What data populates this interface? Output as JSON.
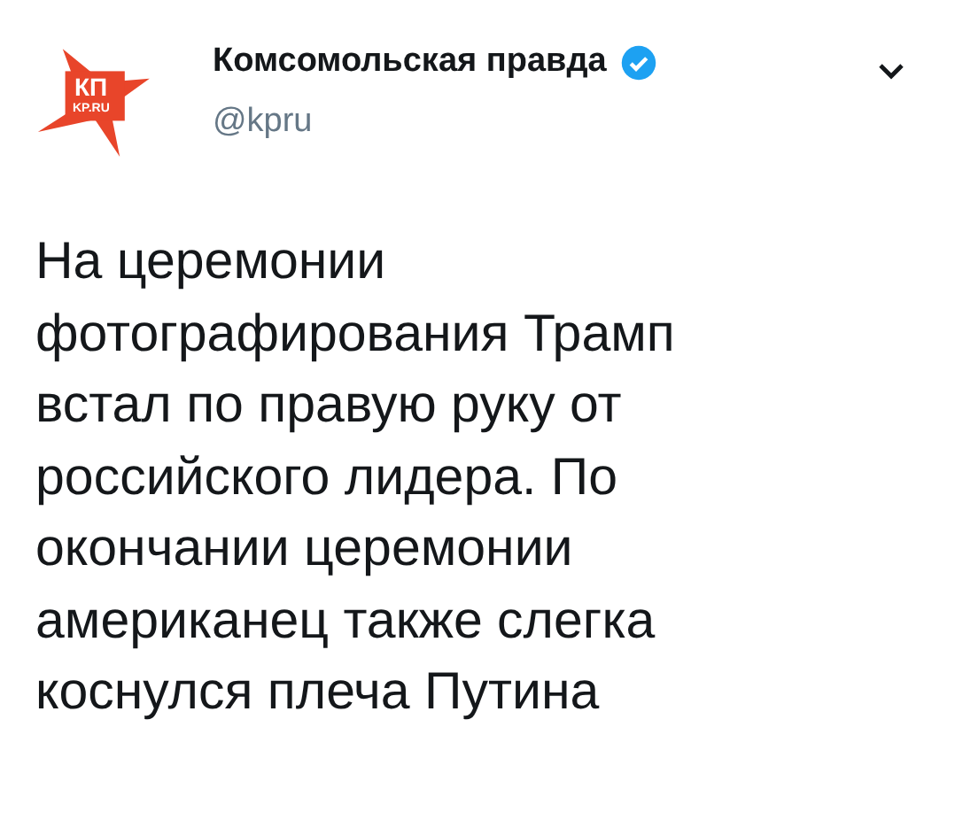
{
  "author": {
    "logo_text": "КП",
    "logo_subtext": "KP.RU",
    "name": "Комсомольская правда",
    "verified": true,
    "handle": "@kpru"
  },
  "tweet": {
    "text": "На церемонии\nфотографирования Трамп\nвстал по правую руку от\nроссийского лидера. По\nокончании церемонии\nамериканец также слегка\nкоснулся плеча Путина"
  }
}
